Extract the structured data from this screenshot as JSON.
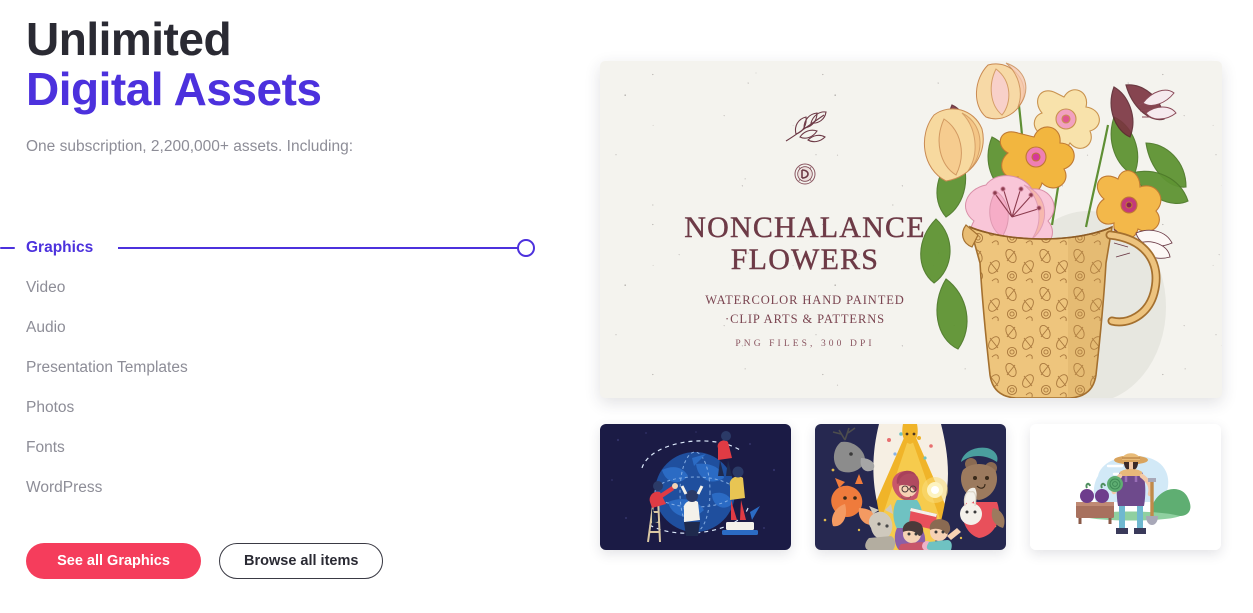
{
  "headline": {
    "line1": "Unlimited",
    "line2": "Digital Assets",
    "accent_color": "#4c31dd",
    "dark_color": "#2a2a33"
  },
  "subheadline": "One subscription, 2,200,000+ assets. Including:",
  "categories": {
    "active_index": 0,
    "slider_value_label": "Graphics",
    "items": [
      {
        "label": "Graphics",
        "active": true
      },
      {
        "label": "Video",
        "active": false
      },
      {
        "label": "Audio",
        "active": false
      },
      {
        "label": "Presentation Templates",
        "active": false
      },
      {
        "label": "Photos",
        "active": false
      },
      {
        "label": "Fonts",
        "active": false
      },
      {
        "label": "WordPress",
        "active": false
      }
    ]
  },
  "buttons": {
    "primary_label": "See all Graphics",
    "primary_color": "#f53d5c",
    "secondary_label": "Browse all items",
    "secondary_border_color": "#3a3a44"
  },
  "hero": {
    "name": "nonchalance-flowers-preview",
    "background_color": "#f4f3ee",
    "ink_color": "#6d3a46",
    "title_line1": "NONCHALANCE",
    "title_line2": "FLOWERS",
    "subtitle_line1": "WATERCOLOR HAND PAINTED",
    "subtitle_line2": "·CLIP ARTS & PATTERNS",
    "meta": "PNG FILES, 300 DPI",
    "artwork_description": "Watercolor bouquet of yellow, orange and pink flowers with green leaves in a patterned tan pitcher"
  },
  "thumbnails": [
    {
      "name": "global-teamwork-illustration",
      "background_color": "#1b1b45",
      "description": "Flat illustration of people around a blue globe with dashed route arcs, ladder and podium"
    },
    {
      "name": "storytime-animals-illustration",
      "background_color": "#f6efe3",
      "description": "Woman reading a red book to children surrounded by deer, fox, bear and rabbit under a starry tent"
    },
    {
      "name": "farmer-gardening-illustration",
      "background_color": "#ffffff",
      "description": "Gardener in straw hat and purple apron holding cabbage and shovel beside a crate of produce"
    }
  ]
}
